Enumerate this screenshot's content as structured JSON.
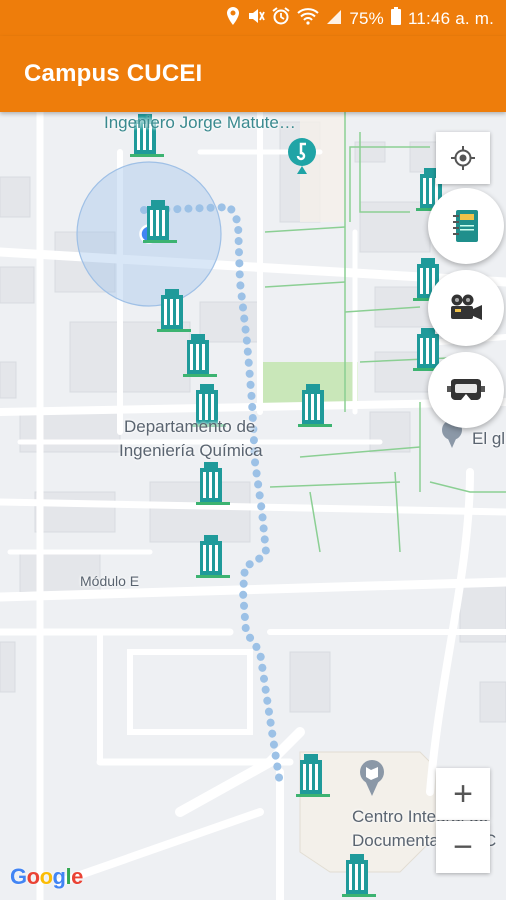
{
  "status_bar": {
    "battery": "75%",
    "time": "11:46 a. m."
  },
  "app_bar": {
    "title": "Campus CUCEI"
  },
  "map": {
    "labels": {
      "top_building": "Ingeniero Jorge Matute…",
      "dept_line1": "Departamento de",
      "dept_line2": "Ingeniería Química",
      "modulo_e": "Módulo E",
      "el_gl": "El gl",
      "centro_line1": "Centro Integral de",
      "centro_line2": "Documentación | C"
    },
    "google_logo": "Google",
    "colors": {
      "accent": "#ee7d0b",
      "building_teal": "#1f9a9a",
      "route_dots": "#9cc1e6",
      "location_blue": "#4285f4"
    }
  },
  "controls": {
    "my_location": "my-location-icon",
    "fab_notebook": "notebook-icon",
    "fab_camera": "movie-camera-icon",
    "fab_vr": "vr-headset-icon",
    "zoom_in": "+",
    "zoom_out": "−"
  }
}
